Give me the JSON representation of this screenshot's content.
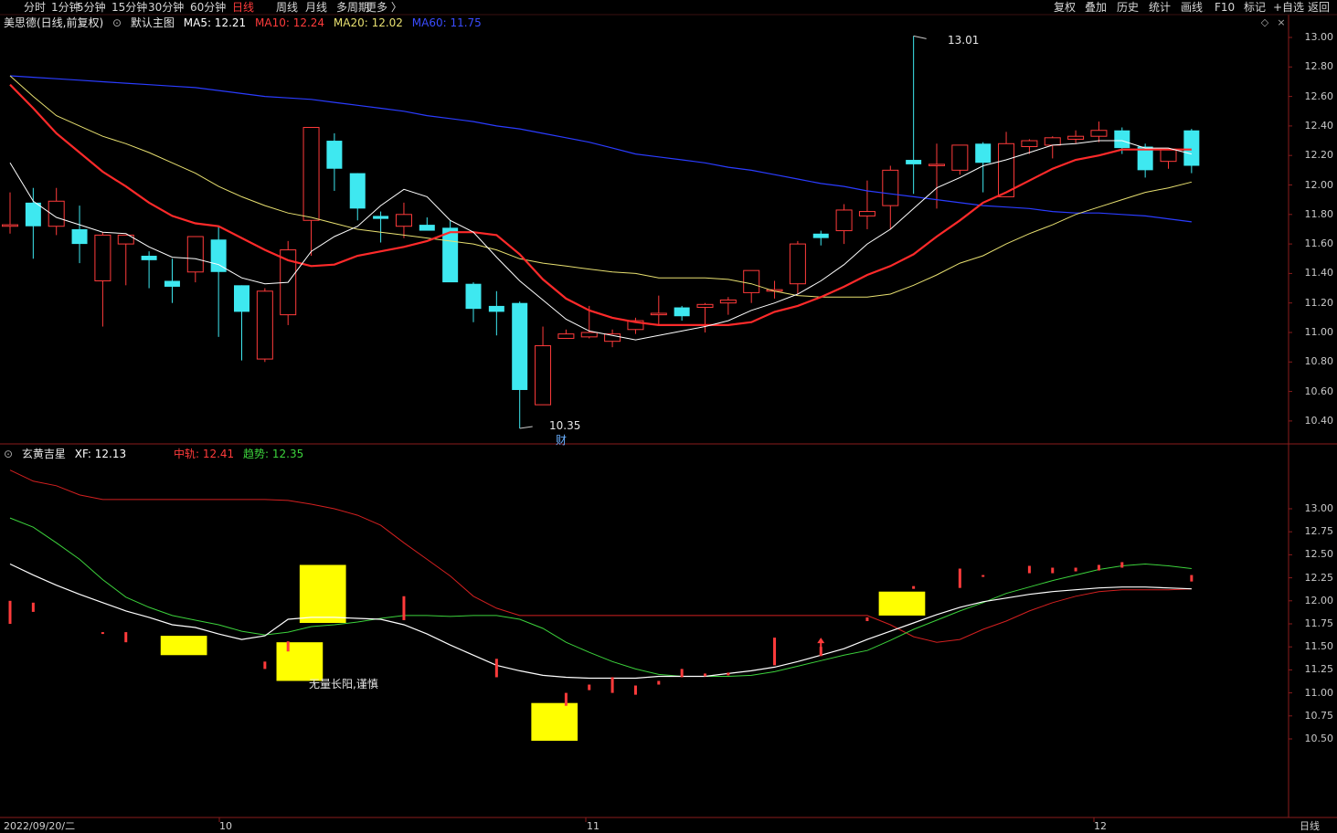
{
  "toolbar": {
    "periods": [
      "分时",
      "1分钟",
      "5分钟",
      "15分钟",
      "30分钟",
      "60分钟",
      "日线",
      "周线",
      "月线",
      "多周期",
      "更多 〉"
    ],
    "active_period": "日线",
    "right_items": [
      "复权",
      "叠加",
      "历史",
      "统计",
      "画线",
      "F10",
      "标记",
      "+自选",
      "返回"
    ]
  },
  "main_chart": {
    "stock_title": "美思德(日线,前复权)",
    "view_label": "默认主图",
    "ma5": "MA5: 12.21",
    "ma10": "MA10: 12.24",
    "ma20": "MA20: 12.02",
    "ma60": "MA60: 11.75",
    "high_label": "13.01",
    "low_label": "10.35",
    "event_label": "财",
    "price_axis": [
      "13.00",
      "12.80",
      "12.60",
      "12.40",
      "12.20",
      "12.00",
      "11.80",
      "11.60",
      "11.40",
      "11.20",
      "11.00",
      "10.80",
      "10.60",
      "10.40"
    ]
  },
  "sub_chart": {
    "indicator_name": "玄黄吉星",
    "xf": "XF: 12.13",
    "zhonggui": "中轨: 12.41",
    "qushi": "趋势: 12.35",
    "annotation": "无量长阳,谨慎",
    "price_axis": [
      "13.00",
      "12.75",
      "12.50",
      "12.25",
      "12.00",
      "11.75",
      "11.50",
      "11.25",
      "11.00",
      "10.75",
      "10.50"
    ]
  },
  "time_axis": {
    "start_date": "2022/09/20/二",
    "ticks": [
      "10",
      "11",
      "12"
    ],
    "period_label": "日线"
  },
  "colors": {
    "up": "#ff3b3b",
    "down": "#3ee8f0",
    "ma5": "#ffffff",
    "ma10": "#ff2a2a",
    "ma20": "#e8e070",
    "ma60": "#2a3cff",
    "zhonggui": "#d42020",
    "qushi": "#3cd23c",
    "xf": "#ffffff",
    "box": "#ffff00"
  },
  "candles": [
    {
      "o": 11.72,
      "h": 11.95,
      "l": 11.67,
      "c": 11.73
    },
    {
      "o": 11.88,
      "h": 11.98,
      "l": 11.5,
      "c": 11.72
    },
    {
      "o": 11.72,
      "h": 11.98,
      "l": 11.66,
      "c": 11.89
    },
    {
      "o": 11.7,
      "h": 11.86,
      "l": 11.47,
      "c": 11.6
    },
    {
      "o": 11.35,
      "h": 11.68,
      "l": 11.04,
      "c": 11.66
    },
    {
      "o": 11.6,
      "h": 11.66,
      "l": 11.32,
      "c": 11.66
    },
    {
      "o": 11.52,
      "h": 11.55,
      "l": 11.3,
      "c": 11.49
    },
    {
      "o": 11.35,
      "h": 11.5,
      "l": 11.2,
      "c": 11.31
    },
    {
      "o": 11.41,
      "h": 11.65,
      "l": 11.34,
      "c": 11.65
    },
    {
      "o": 11.63,
      "h": 11.72,
      "l": 10.97,
      "c": 11.41
    },
    {
      "o": 11.32,
      "h": 11.32,
      "l": 10.81,
      "c": 11.14
    },
    {
      "o": 10.82,
      "h": 11.3,
      "l": 10.8,
      "c": 11.28
    },
    {
      "o": 11.12,
      "h": 11.62,
      "l": 11.05,
      "c": 11.56
    },
    {
      "o": 11.76,
      "h": 12.39,
      "l": 11.52,
      "c": 12.39
    },
    {
      "o": 12.3,
      "h": 12.35,
      "l": 11.96,
      "c": 12.11
    },
    {
      "o": 12.08,
      "h": 12.08,
      "l": 11.76,
      "c": 11.84
    },
    {
      "o": 11.79,
      "h": 11.82,
      "l": 11.61,
      "c": 11.77
    },
    {
      "o": 11.72,
      "h": 11.88,
      "l": 11.64,
      "c": 11.8
    },
    {
      "o": 11.73,
      "h": 11.78,
      "l": 11.72,
      "c": 11.69
    },
    {
      "o": 11.71,
      "h": 11.76,
      "l": 11.39,
      "c": 11.34
    },
    {
      "o": 11.33,
      "h": 11.34,
      "l": 11.07,
      "c": 11.16
    },
    {
      "o": 11.18,
      "h": 11.28,
      "l": 10.98,
      "c": 11.14
    },
    {
      "o": 11.2,
      "h": 11.21,
      "l": 10.35,
      "c": 10.61
    },
    {
      "o": 10.51,
      "h": 11.04,
      "l": 10.51,
      "c": 10.91
    },
    {
      "o": 10.96,
      "h": 11.02,
      "l": 10.96,
      "c": 10.99
    },
    {
      "o": 10.97,
      "h": 11.18,
      "l": 10.96,
      "c": 11.0
    },
    {
      "o": 10.94,
      "h": 11.02,
      "l": 10.9,
      "c": 10.99
    },
    {
      "o": 11.02,
      "h": 11.1,
      "l": 10.99,
      "c": 11.08
    },
    {
      "o": 11.12,
      "h": 11.25,
      "l": 11.05,
      "c": 11.13
    },
    {
      "o": 11.17,
      "h": 11.18,
      "l": 11.08,
      "c": 11.11
    },
    {
      "o": 11.17,
      "h": 11.2,
      "l": 11.0,
      "c": 11.19
    },
    {
      "o": 11.2,
      "h": 11.24,
      "l": 11.12,
      "c": 11.22
    },
    {
      "o": 11.27,
      "h": 11.42,
      "l": 11.2,
      "c": 11.42
    },
    {
      "o": 11.28,
      "h": 11.35,
      "l": 11.23,
      "c": 11.29
    },
    {
      "o": 11.33,
      "h": 11.62,
      "l": 11.26,
      "c": 11.6
    },
    {
      "o": 11.67,
      "h": 11.69,
      "l": 11.59,
      "c": 11.64
    },
    {
      "o": 11.69,
      "h": 11.87,
      "l": 11.6,
      "c": 11.83
    },
    {
      "o": 11.79,
      "h": 12.03,
      "l": 11.7,
      "c": 11.82
    },
    {
      "o": 11.86,
      "h": 12.13,
      "l": 11.7,
      "c": 12.1
    },
    {
      "o": 12.17,
      "h": 13.01,
      "l": 11.94,
      "c": 12.14
    },
    {
      "o": 12.14,
      "h": 12.28,
      "l": 11.84,
      "c": 12.14
    },
    {
      "o": 12.1,
      "h": 12.27,
      "l": 12.07,
      "c": 12.27
    },
    {
      "o": 12.28,
      "h": 12.29,
      "l": 11.95,
      "c": 12.15
    },
    {
      "o": 11.92,
      "h": 12.36,
      "l": 11.92,
      "c": 12.28
    },
    {
      "o": 12.26,
      "h": 12.31,
      "l": 12.21,
      "c": 12.3
    },
    {
      "o": 12.27,
      "h": 12.33,
      "l": 12.18,
      "c": 12.32
    },
    {
      "o": 12.31,
      "h": 12.37,
      "l": 12.28,
      "c": 12.33
    },
    {
      "o": 12.33,
      "h": 12.43,
      "l": 12.29,
      "c": 12.37
    },
    {
      "o": 12.37,
      "h": 12.39,
      "l": 12.21,
      "c": 12.25
    },
    {
      "o": 12.26,
      "h": 12.28,
      "l": 12.05,
      "c": 12.1
    },
    {
      "o": 12.16,
      "h": 12.24,
      "l": 12.11,
      "c": 12.24
    },
    {
      "o": 12.37,
      "h": 12.38,
      "l": 12.08,
      "c": 12.13
    }
  ],
  "ma_series": {
    "ma5": [
      12.15,
      11.89,
      11.78,
      11.73,
      11.68,
      11.67,
      11.58,
      11.51,
      11.5,
      11.46,
      11.37,
      11.33,
      11.34,
      11.55,
      11.65,
      11.72,
      11.86,
      11.97,
      11.92,
      11.76,
      11.68,
      11.51,
      11.35,
      11.22,
      11.09,
      11.01,
      10.98,
      10.95,
      10.98,
      11.01,
      11.04,
      11.08,
      11.15,
      11.2,
      11.26,
      11.35,
      11.46,
      11.6,
      11.7,
      11.84,
      11.98,
      12.05,
      12.13,
      12.17,
      12.22,
      12.27,
      12.28,
      12.3,
      12.3,
      12.25,
      12.25,
      12.21
    ],
    "ma10": [
      12.68,
      12.52,
      12.35,
      12.22,
      12.09,
      11.99,
      11.88,
      11.79,
      11.74,
      11.72,
      11.64,
      11.56,
      11.49,
      11.45,
      11.46,
      11.52,
      11.55,
      11.58,
      11.62,
      11.68,
      11.68,
      11.66,
      11.53,
      11.36,
      11.23,
      11.15,
      11.1,
      11.07,
      11.05,
      11.05,
      11.05,
      11.05,
      11.07,
      11.14,
      11.18,
      11.24,
      11.31,
      11.39,
      11.45,
      11.53,
      11.65,
      11.76,
      11.88,
      11.95,
      12.03,
      12.11,
      12.17,
      12.2,
      12.24,
      12.24,
      12.24,
      12.24
    ],
    "ma20": [
      12.74,
      12.6,
      12.47,
      12.4,
      12.33,
      12.28,
      12.22,
      12.15,
      12.08,
      11.99,
      11.92,
      11.86,
      11.81,
      11.78,
      11.74,
      11.7,
      11.68,
      11.66,
      11.64,
      11.62,
      11.6,
      11.56,
      11.5,
      11.47,
      11.45,
      11.43,
      11.41,
      11.4,
      11.37,
      11.37,
      11.37,
      11.36,
      11.33,
      11.28,
      11.25,
      11.24,
      11.24,
      11.24,
      11.26,
      11.32,
      11.39,
      11.47,
      11.52,
      11.6,
      11.67,
      11.73,
      11.8,
      11.85,
      11.9,
      11.95,
      11.98,
      12.02
    ],
    "ma60": [
      12.74,
      12.73,
      12.72,
      12.71,
      12.7,
      12.69,
      12.68,
      12.67,
      12.66,
      12.64,
      12.62,
      12.6,
      12.59,
      12.58,
      12.56,
      12.54,
      12.52,
      12.5,
      12.47,
      12.45,
      12.43,
      12.4,
      12.38,
      12.35,
      12.32,
      12.29,
      12.25,
      12.21,
      12.19,
      12.17,
      12.15,
      12.12,
      12.1,
      12.07,
      12.04,
      12.01,
      11.99,
      11.96,
      11.94,
      11.92,
      11.9,
      11.88,
      11.86,
      11.85,
      11.84,
      11.82,
      11.81,
      11.81,
      11.8,
      11.79,
      11.77,
      11.75
    ]
  },
  "sub_series": {
    "zhonggui": [
      13.42,
      13.3,
      13.25,
      13.15,
      13.1,
      13.1,
      13.1,
      13.1,
      13.1,
      13.1,
      13.1,
      13.1,
      13.09,
      13.05,
      13.0,
      12.93,
      12.82,
      12.63,
      12.45,
      12.27,
      12.05,
      11.92,
      11.84,
      11.84,
      11.84,
      11.84,
      11.84,
      11.84,
      11.84,
      11.84,
      11.84,
      11.84,
      11.84,
      11.84,
      11.84,
      11.84,
      11.84,
      11.84,
      11.74,
      11.61,
      11.55,
      11.58,
      11.69,
      11.78,
      11.89,
      11.98,
      12.05,
      12.1,
      12.12,
      12.12,
      12.12,
      12.13
    ],
    "qushi": [
      12.9,
      12.8,
      12.63,
      12.45,
      12.23,
      12.04,
      11.93,
      11.84,
      11.79,
      11.74,
      11.67,
      11.63,
      11.66,
      11.72,
      11.74,
      11.77,
      11.81,
      11.84,
      11.84,
      11.83,
      11.84,
      11.84,
      11.8,
      11.7,
      11.55,
      11.44,
      11.34,
      11.26,
      11.2,
      11.18,
      11.18,
      11.18,
      11.19,
      11.23,
      11.29,
      11.35,
      11.41,
      11.46,
      11.57,
      11.69,
      11.79,
      11.89,
      11.98,
      12.08,
      12.15,
      12.22,
      12.28,
      12.34,
      12.38,
      12.4,
      12.38,
      12.35
    ],
    "xf": [
      12.4,
      12.28,
      12.17,
      12.07,
      11.98,
      11.89,
      11.82,
      11.74,
      11.71,
      11.64,
      11.58,
      11.62,
      11.8,
      11.82,
      11.82,
      11.81,
      11.8,
      11.74,
      11.64,
      11.52,
      11.41,
      11.3,
      11.24,
      11.19,
      11.17,
      11.16,
      11.16,
      11.16,
      11.18,
      11.18,
      11.18,
      11.21,
      11.24,
      11.28,
      11.34,
      11.41,
      11.48,
      11.58,
      11.67,
      11.76,
      11.85,
      11.93,
      11.99,
      12.03,
      12.07,
      12.1,
      12.12,
      12.14,
      12.15,
      12.15,
      12.14,
      12.13
    ],
    "red_bars": [
      {
        "i": 0,
        "a": 11.75,
        "b": 12.0
      },
      {
        "i": 1,
        "a": 11.88,
        "b": 11.98
      },
      {
        "i": 4,
        "a": 11.66,
        "b": 11.64
      },
      {
        "i": 5,
        "a": 11.55,
        "b": 11.66
      },
      {
        "i": 11,
        "a": 11.34,
        "b": 11.26
      },
      {
        "i": 12,
        "a": 11.45,
        "b": 11.56
      },
      {
        "i": 17,
        "a": 11.79,
        "b": 12.05
      },
      {
        "i": 21,
        "a": 11.17,
        "b": 11.37
      },
      {
        "i": 24,
        "a": 10.86,
        "b": 11.0
      },
      {
        "i": 25,
        "a": 11.03,
        "b": 11.09
      },
      {
        "i": 26,
        "a": 11.0,
        "b": 11.17
      },
      {
        "i": 27,
        "a": 10.98,
        "b": 11.08
      },
      {
        "i": 28,
        "a": 11.09,
        "b": 11.13
      },
      {
        "i": 29,
        "a": 11.17,
        "b": 11.26
      },
      {
        "i": 30,
        "a": 11.18,
        "b": 11.21
      },
      {
        "i": 31,
        "a": 11.19,
        "b": 11.22
      },
      {
        "i": 33,
        "a": 11.3,
        "b": 11.6
      },
      {
        "i": 35,
        "a": 11.4,
        "b": 11.5
      },
      {
        "i": 37,
        "a": 11.78,
        "b": 11.82
      },
      {
        "i": 39,
        "a": 12.13,
        "b": 12.16
      },
      {
        "i": 41,
        "a": 12.14,
        "b": 12.35
      },
      {
        "i": 42,
        "a": 12.28,
        "b": 12.26
      },
      {
        "i": 44,
        "a": 12.3,
        "b": 12.38
      },
      {
        "i": 45,
        "a": 12.3,
        "b": 12.36
      },
      {
        "i": 46,
        "a": 12.32,
        "b": 12.36
      },
      {
        "i": 47,
        "a": 12.33,
        "b": 12.39
      },
      {
        "i": 48,
        "a": 12.36,
        "b": 12.42
      },
      {
        "i": 51,
        "a": 12.21,
        "b": 12.28
      }
    ],
    "yellow_boxes": [
      {
        "i0": 6.5,
        "i1": 8.5,
        "top": 11.62,
        "bot": 11.41
      },
      {
        "i0": 11.5,
        "i1": 13.5,
        "top": 11.55,
        "bot": 11.13
      },
      {
        "i0": 12.5,
        "i1": 14.5,
        "top": 12.39,
        "bot": 11.76
      },
      {
        "i0": 22.5,
        "i1": 24.5,
        "top": 10.89,
        "bot": 10.48
      },
      {
        "i0": 37.5,
        "i1": 39.5,
        "top": 12.1,
        "bot": 11.84
      }
    ]
  }
}
